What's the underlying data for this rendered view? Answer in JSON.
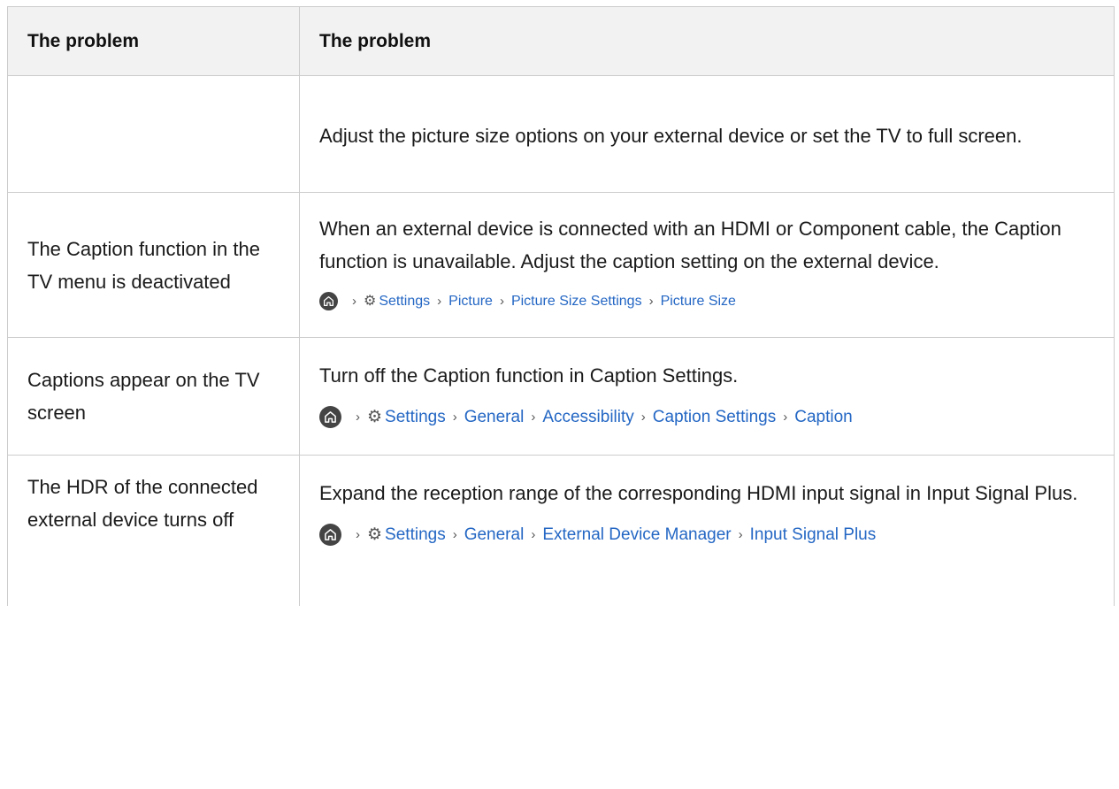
{
  "table": {
    "headers": [
      "The problem",
      "The problem"
    ],
    "rows": [
      {
        "problem": "",
        "solution": "Adjust the picture size options on your external device or set the TV to full screen."
      },
      {
        "problem": "The Caption function in the TV menu is deactivated",
        "solution": "When an external device is connected with an HDMI or Component cable, the Caption function is unavailable. Adjust the caption setting on the external device.",
        "path": [
          "Settings",
          "Picture",
          "Picture Size Settings",
          "Picture Size"
        ]
      },
      {
        "problem": "Captions appear on the TV screen",
        "solution": "Turn off the Caption function in Caption Settings.",
        "path": [
          "Settings",
          "General",
          "Accessibility",
          "Caption Settings",
          "Caption"
        ]
      },
      {
        "problem": "The HDR of the connected external device turns off",
        "solution": "Expand the reception range of the corresponding HDMI input signal in Input Signal Plus.",
        "path": [
          "Settings",
          "General",
          "External Device Manager",
          "Input Signal Plus"
        ]
      }
    ]
  },
  "colors": {
    "link": "#2467c4",
    "header_bg": "#f2f2f2",
    "border": "#cccccc"
  },
  "icons": {
    "home": "home-icon",
    "settings": "gear-icon",
    "separator": "chevron-right-icon"
  }
}
